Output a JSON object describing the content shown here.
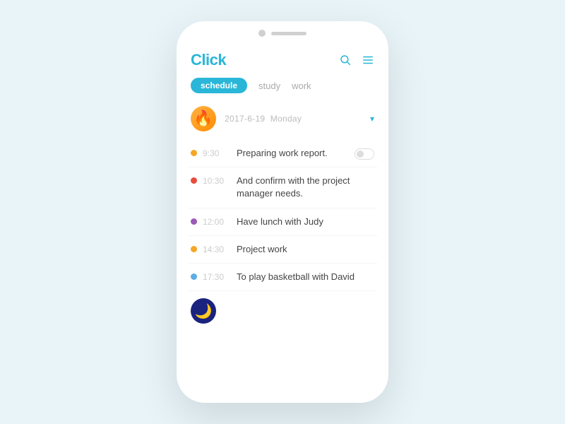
{
  "app": {
    "logo": "Click",
    "background_color": "#e8f4f8"
  },
  "header": {
    "logo_label": "Click",
    "search_icon": "search",
    "menu_icon": "menu"
  },
  "nav": {
    "tabs": [
      {
        "id": "schedule",
        "label": "schedule",
        "active": true
      },
      {
        "id": "study",
        "label": "study",
        "active": false
      },
      {
        "id": "work",
        "label": "work",
        "active": false
      }
    ]
  },
  "schedule": {
    "date": {
      "text": "2017-6-19",
      "day": "Monday",
      "dropdown_icon": "▾"
    },
    "tasks": [
      {
        "time": "9:30",
        "text": "Preparing work report.",
        "dot_color": "orange",
        "has_toggle": true
      },
      {
        "time": "10:30",
        "text": "And confirm with the project manager needs.",
        "dot_color": "red",
        "has_toggle": false
      },
      {
        "time": "12:00",
        "text": "Have lunch with Judy",
        "dot_color": "purple",
        "has_toggle": false
      },
      {
        "time": "14:30",
        "text": "Project work",
        "dot_color": "yellow",
        "has_toggle": false
      },
      {
        "time": "17:30",
        "text": "To play basketball with David",
        "dot_color": "blue",
        "has_toggle": false
      }
    ]
  }
}
